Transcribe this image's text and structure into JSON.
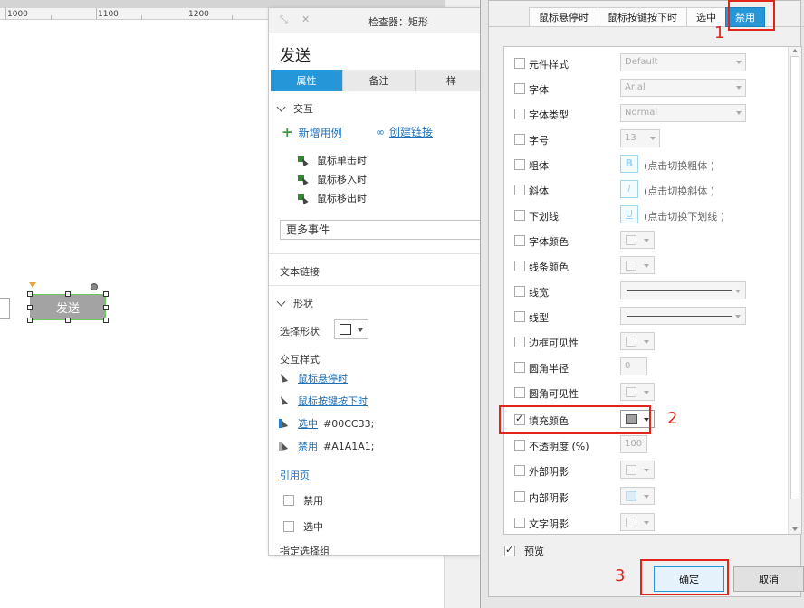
{
  "ruler": {
    "labels": [
      "1000",
      "1100",
      "1200"
    ]
  },
  "canvas": {
    "widget_label": "发送"
  },
  "inspector": {
    "title": "检查器：矩形",
    "widget_name": "发送",
    "tabs": [
      "属性",
      "备注",
      "样"
    ],
    "interaction": {
      "heading": "交互",
      "add_case": "新增用例",
      "create_link": "创建链接",
      "events": [
        "鼠标单击时",
        "鼠标移入时",
        "鼠标移出时"
      ],
      "more_events": "更多事件"
    },
    "text_link": "文本链接",
    "shape": {
      "heading": "形状",
      "select_label": "选择形状"
    },
    "interaction_styles": {
      "heading": "交互样式",
      "items": [
        {
          "label": "鼠标悬停时",
          "value": ""
        },
        {
          "label": "鼠标按键按下时",
          "value": ""
        },
        {
          "label": "选中",
          "value": "#00CC33;"
        },
        {
          "label": "禁用",
          "value": "#A1A1A1;"
        }
      ]
    },
    "ref_page": "引用页",
    "checkboxes": [
      {
        "label": "禁用",
        "checked": false
      },
      {
        "label": "选中",
        "checked": false
      }
    ],
    "group_partial": "指定选择组"
  },
  "dialog": {
    "tabs": [
      "鼠标悬停时",
      "鼠标按键按下时",
      "选中",
      "禁用"
    ],
    "active_tab": "禁用",
    "rows": [
      {
        "label": "元件样式",
        "control": "select",
        "value": "Default"
      },
      {
        "label": "字体",
        "control": "select",
        "value": "Arial"
      },
      {
        "label": "字体类型",
        "control": "select",
        "value": "Normal"
      },
      {
        "label": "字号",
        "control": "small-select",
        "value": "13"
      },
      {
        "label": "粗体",
        "control": "toggle",
        "glyph": "B",
        "hint": "(点击切换粗体 )"
      },
      {
        "label": "斜体",
        "control": "toggle",
        "glyph": "I",
        "hint": "(点击切换斜体 )"
      },
      {
        "label": "下划线",
        "control": "toggle",
        "glyph": "U",
        "hint": "(点击切换下划线 )"
      },
      {
        "label": "字体颜色",
        "control": "color"
      },
      {
        "label": "线条颜色",
        "control": "color"
      },
      {
        "label": "线宽",
        "control": "line"
      },
      {
        "label": "线型",
        "control": "line"
      },
      {
        "label": "边框可见性",
        "control": "color"
      },
      {
        "label": "圆角半径",
        "control": "number",
        "value": "0"
      },
      {
        "label": "圆角可见性",
        "control": "color"
      },
      {
        "label": "填充颜色",
        "control": "fill",
        "checked": true,
        "value": "#A1A1A1"
      },
      {
        "label": "不透明度 (%)",
        "control": "number",
        "value": "100"
      },
      {
        "label": "外部阴影",
        "control": "color"
      },
      {
        "label": "内部阴影",
        "control": "color"
      },
      {
        "label": "文字阴影",
        "control": "color"
      }
    ],
    "preview_label": "预览",
    "preview_checked": true,
    "ok_label": "确定",
    "cancel_label": "取消"
  },
  "annotations": [
    "1",
    "2",
    "3"
  ],
  "colors": {
    "accent_blue": "#2596d8",
    "annotation_red": "#e1251b",
    "selected_color": "#00CC33",
    "disabled_fill": "#A1A1A1"
  }
}
